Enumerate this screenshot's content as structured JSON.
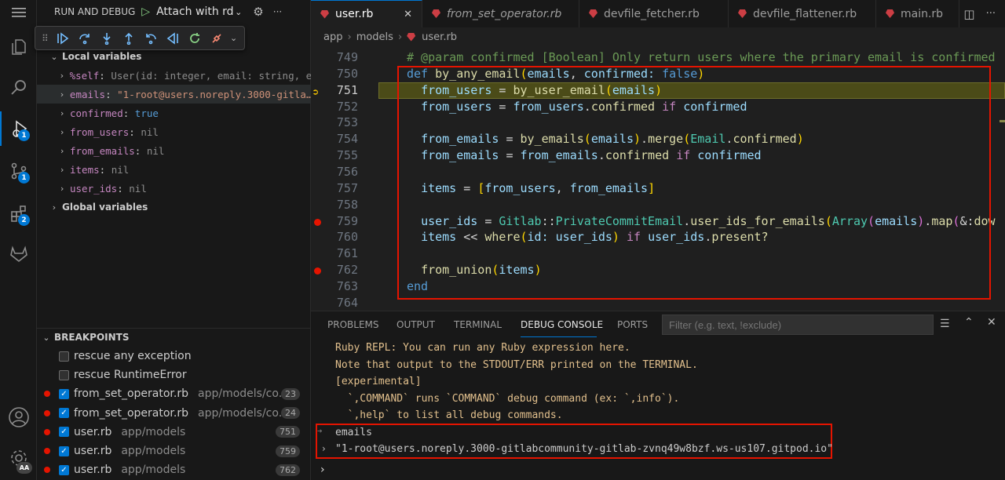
{
  "colors": {
    "accent": "#0078d4",
    "breakpoint": "#e51400",
    "highlight": "#e51400"
  },
  "activity": [
    {
      "name": "explorer-icon"
    },
    {
      "name": "search-icon"
    },
    {
      "name": "run-debug-icon",
      "badge": "1"
    },
    {
      "name": "source-control-icon",
      "badge": "1"
    },
    {
      "name": "extensions-icon",
      "badge": "2"
    },
    {
      "name": "gitlab-icon"
    }
  ],
  "account_badge": "AA",
  "sidebar": {
    "title": "RUN AND DEBUG",
    "config": "Attach with rdb",
    "sections": {
      "local": "Local variables",
      "global": "Global variables",
      "breakpoints": "BREAKPOINTS"
    },
    "vars": [
      {
        "name": "%self",
        "value": "User(id: integer, email: string, e…",
        "type": "vv"
      },
      {
        "name": "emails",
        "value": "\"1-root@users.noreply.3000-gitla…",
        "type": "vs"
      },
      {
        "name": "confirmed",
        "value": "true",
        "type": "vb"
      },
      {
        "name": "from_users",
        "value": "nil",
        "type": "vv"
      },
      {
        "name": "from_emails",
        "value": "nil",
        "type": "vv"
      },
      {
        "name": "items",
        "value": "nil",
        "type": "vv"
      },
      {
        "name": "user_ids",
        "value": "nil",
        "type": "vv"
      }
    ],
    "breakpoints": [
      {
        "label": "rescue any exception",
        "path": "",
        "count": "",
        "dot": false,
        "checked": false
      },
      {
        "label": "rescue RuntimeError",
        "path": "",
        "count": "",
        "dot": false,
        "checked": false
      },
      {
        "label": "from_set_operator.rb",
        "path": "app/models/co...",
        "count": "23",
        "dot": true,
        "checked": true
      },
      {
        "label": "from_set_operator.rb",
        "path": "app/models/co...",
        "count": "24",
        "dot": true,
        "checked": true
      },
      {
        "label": "user.rb",
        "path": "app/models",
        "count": "751",
        "dot": true,
        "checked": true
      },
      {
        "label": "user.rb",
        "path": "app/models",
        "count": "759",
        "dot": true,
        "checked": true
      },
      {
        "label": "user.rb",
        "path": "app/models",
        "count": "762",
        "dot": true,
        "checked": true
      }
    ]
  },
  "tabs": [
    {
      "label": "user.rb",
      "active": true,
      "italic": false
    },
    {
      "label": "from_set_operator.rb",
      "active": false,
      "italic": true
    },
    {
      "label": "devfile_fetcher.rb",
      "active": false,
      "italic": false
    },
    {
      "label": "devfile_flattener.rb",
      "active": false,
      "italic": false
    },
    {
      "label": "main.rb",
      "active": false,
      "italic": false
    }
  ],
  "breadcrumb": [
    "app",
    "models",
    "user.rb"
  ],
  "code": {
    "lines": [
      {
        "n": "749",
        "html": "<span class='cmt'># @param confirmed [Boolean] Only return users where the primary email is confirmed</span>",
        "bp": false,
        "cur": false
      },
      {
        "n": "750",
        "html": "<span class='kw2'>def</span> <span class='fn'>by_any_email</span><span class='bkt'>(</span><span class='var'>emails</span><span class='op'>, </span><span class='var'>confirmed:</span> <span class='kw2'>false</span><span class='bkt'>)</span>",
        "bp": false,
        "cur": false
      },
      {
        "n": "751",
        "html": "  <span class='var'>from_users</span> <span class='op'>=</span> <span class='fn'>by_user_email</span><span class='bkt'>(</span><span class='var'>emails</span><span class='bkt'>)</span>",
        "bp": false,
        "cur": true
      },
      {
        "n": "752",
        "html": "  <span class='var'>from_users</span> <span class='op'>=</span> <span class='var'>from_users</span><span class='op'>.</span><span class='fn'>confirmed</span> <span class='kw'>if</span> <span class='var'>confirmed</span>",
        "bp": false,
        "cur": false
      },
      {
        "n": "753",
        "html": "",
        "bp": false,
        "cur": false
      },
      {
        "n": "754",
        "html": "  <span class='var'>from_emails</span> <span class='op'>=</span> <span class='fn'>by_emails</span><span class='bkt'>(</span><span class='var'>emails</span><span class='bkt'>)</span><span class='op'>.</span><span class='fn'>merge</span><span class='bkt'>(</span><span class='cls'>Email</span><span class='op'>.</span><span class='fn'>confirmed</span><span class='bkt'>)</span>",
        "bp": false,
        "cur": false
      },
      {
        "n": "755",
        "html": "  <span class='var'>from_emails</span> <span class='op'>=</span> <span class='var'>from_emails</span><span class='op'>.</span><span class='fn'>confirmed</span> <span class='kw'>if</span> <span class='var'>confirmed</span>",
        "bp": false,
        "cur": false
      },
      {
        "n": "756",
        "html": "",
        "bp": false,
        "cur": false
      },
      {
        "n": "757",
        "html": "  <span class='var'>items</span> <span class='op'>=</span> <span class='bkt'>[</span><span class='var'>from_users</span><span class='op'>, </span><span class='var'>from_emails</span><span class='bkt'>]</span>",
        "bp": false,
        "cur": false
      },
      {
        "n": "758",
        "html": "",
        "bp": false,
        "cur": false
      },
      {
        "n": "759",
        "html": "  <span class='var'>user_ids</span> <span class='op'>=</span> <span class='cls'>Gitlab</span><span class='op'>::</span><span class='cls'>PrivateCommitEmail</span><span class='op'>.</span><span class='fn'>user_ids_for_emails</span><span class='bkt'>(</span><span class='cls'>Array</span><span class='bkt2'>(</span><span class='var'>emails</span><span class='bkt2'>)</span><span class='op'>.</span><span class='fn'>map</span><span class='bkt2'>(</span><span class='op'>&amp;:</span><span class='fn'>dow</span>",
        "bp": true,
        "cur": false
      },
      {
        "n": "760",
        "html": "  <span class='var'>items</span> <span class='op'>&lt;&lt;</span> <span class='fn'>where</span><span class='bkt'>(</span><span class='var'>id:</span> <span class='var'>user_ids</span><span class='bkt'>)</span> <span class='kw'>if</span> <span class='var'>user_ids</span><span class='op'>.</span><span class='fn'>present?</span>",
        "bp": false,
        "cur": false
      },
      {
        "n": "761",
        "html": "",
        "bp": false,
        "cur": false
      },
      {
        "n": "762",
        "html": "  <span class='fn'>from_union</span><span class='bkt'>(</span><span class='var'>items</span><span class='bkt'>)</span>",
        "bp": true,
        "cur": false
      },
      {
        "n": "763",
        "html": "<span class='kw2'>end</span>",
        "bp": false,
        "cur": false
      },
      {
        "n": "764",
        "html": "",
        "bp": false,
        "cur": false
      }
    ]
  },
  "panel": {
    "tabs": [
      "PROBLEMS",
      "OUTPUT",
      "TERMINAL",
      "DEBUG CONSOLE",
      "PORTS"
    ],
    "active": "DEBUG CONSOLE",
    "filter_placeholder": "Filter (e.g. text, !exclude)",
    "console": [
      "Ruby REPL: You can run any Ruby expression here.",
      "Note that output to the STDOUT/ERR printed on the TERMINAL.",
      "[experimental]",
      "  `,COMMAND` runs `COMMAND` debug command (ex: `,info`).",
      "  `,help` to list all debug commands."
    ],
    "input_echo": "emails",
    "result": "\"1-root@users.noreply.3000-gitlabcommunity-gitlab-zvnq49w8bzf.ws-us107.gitpod.io\""
  }
}
